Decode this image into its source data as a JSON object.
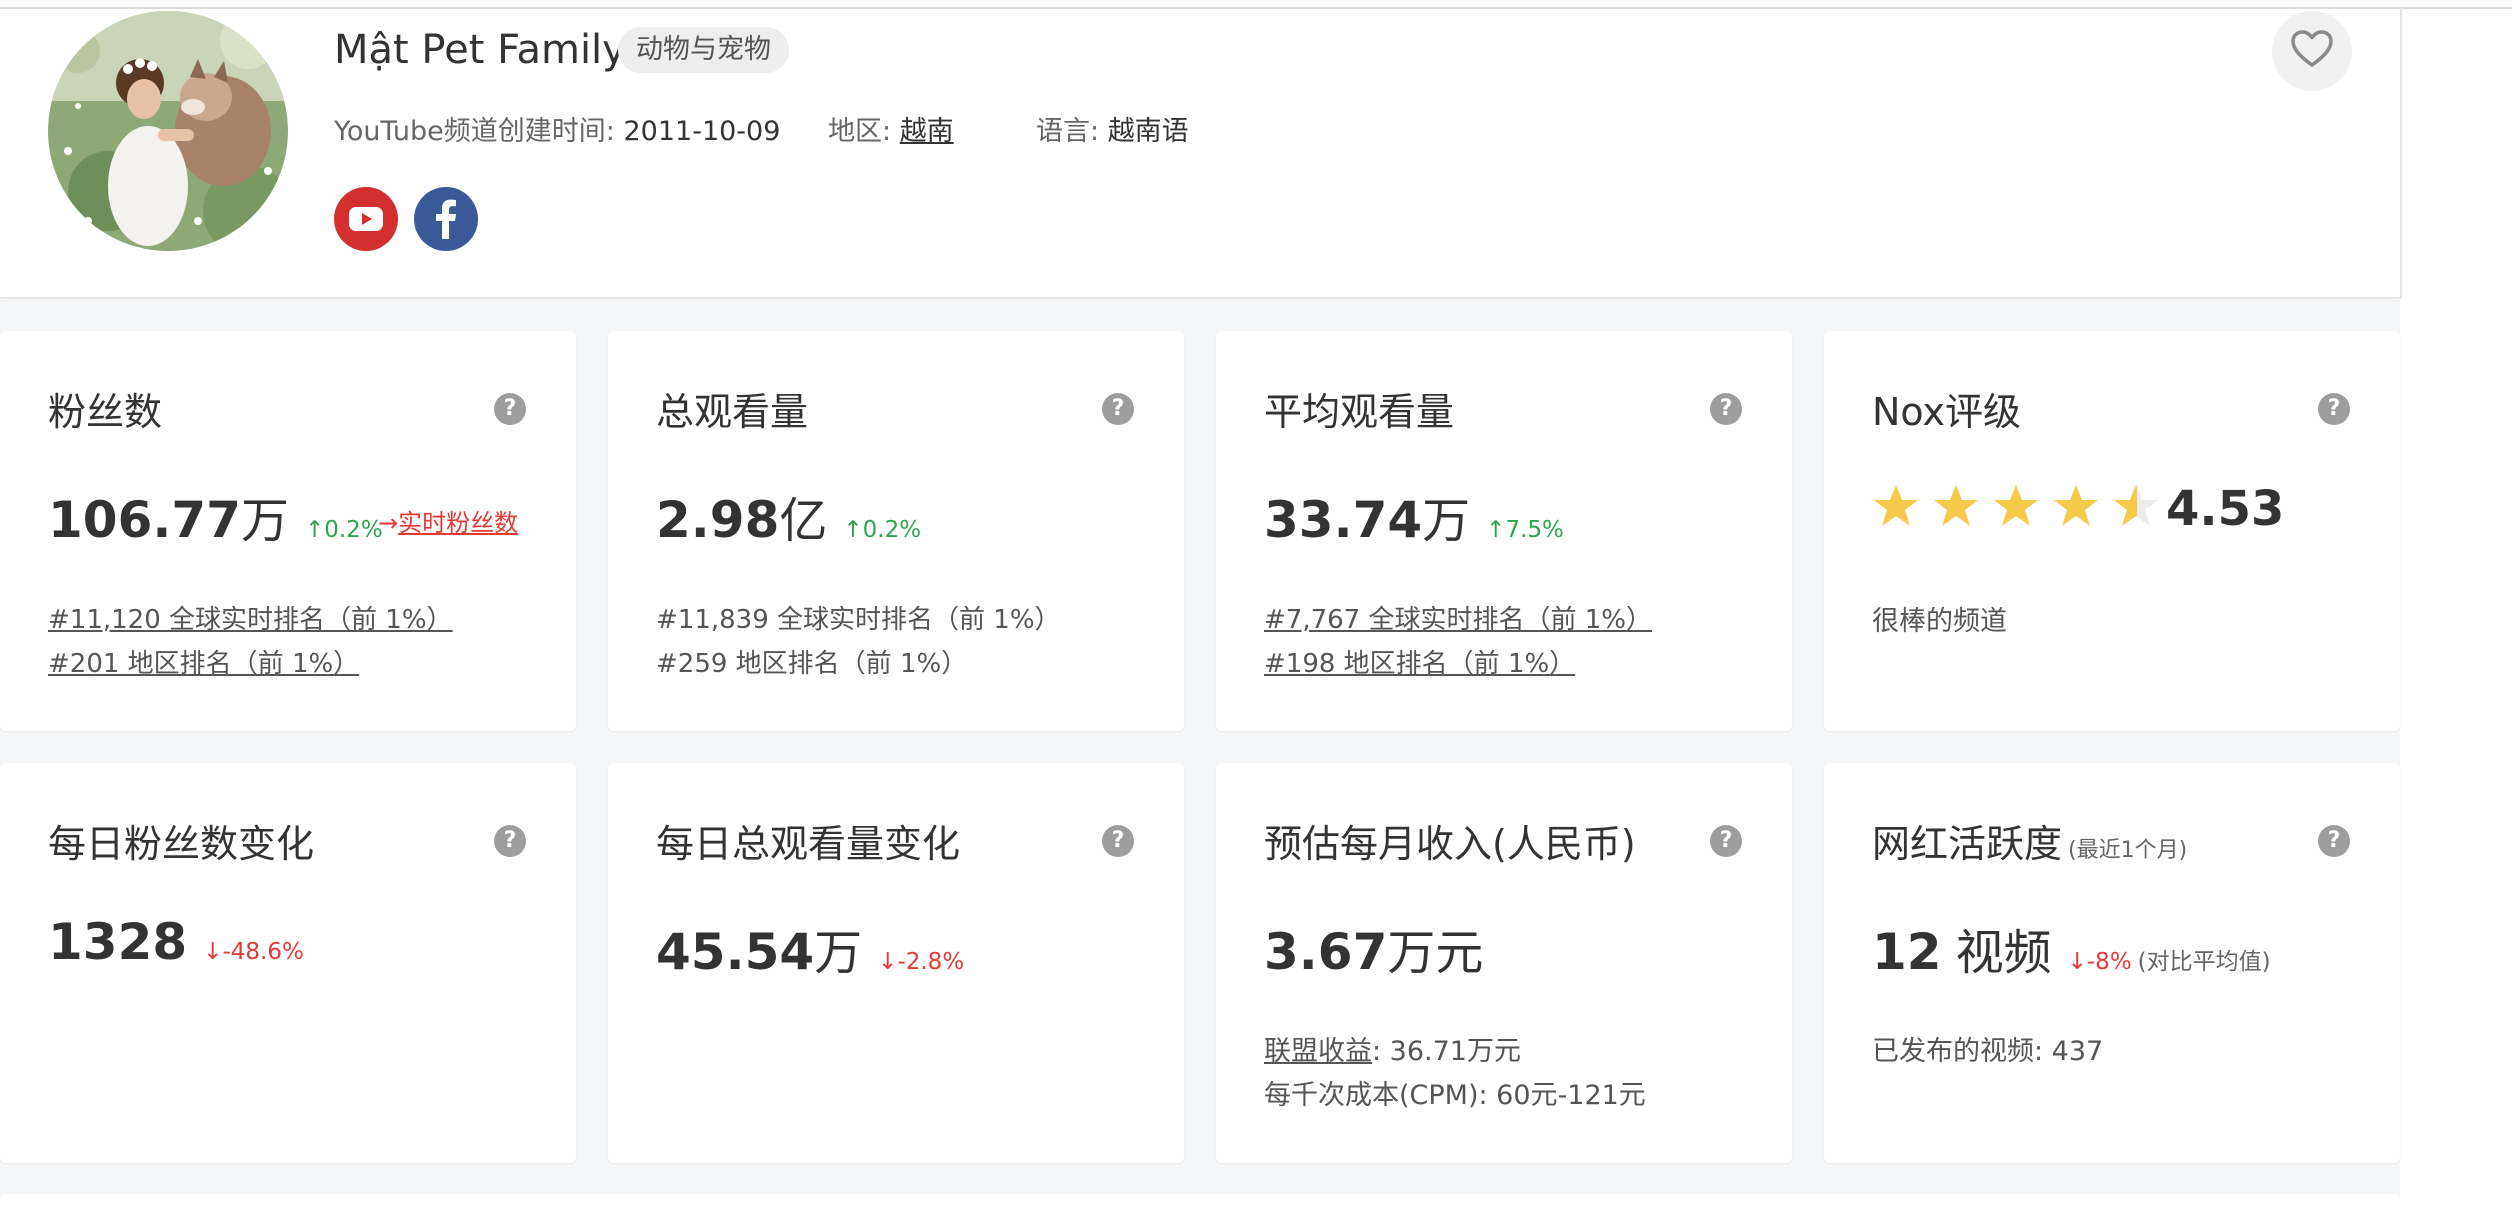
{
  "channel": {
    "name": "Mật Pet Family",
    "category": "动物与宠物",
    "created_label": "YouTube频道创建时间: ",
    "created_date": "2011-10-09",
    "region_label": "地区: ",
    "region": "越南",
    "language_label": "语言: ",
    "language": "越南语"
  },
  "icons": {
    "youtube": "youtube-icon",
    "facebook": "facebook-icon",
    "favorite": "heart-icon",
    "help": "question-icon"
  },
  "colors": {
    "youtube_red": "#d32f2f",
    "facebook_blue": "#3b5998",
    "up_green": "#2ea44f",
    "down_red": "#e53935",
    "star_yellow": "#f7c94a"
  },
  "cards": {
    "subscribers": {
      "title": "粉丝数",
      "value": "106.77",
      "unit": "万",
      "change": "↑0.2%",
      "realtime_link": "实时粉丝数",
      "rank_global": "#11,120 全球实时排名（前 1%）",
      "rank_region": "#201 地区排名（前 1%）"
    },
    "total_views": {
      "title": "总观看量",
      "value": "2.98",
      "unit": "亿",
      "change": "↑0.2%",
      "rank_global": "#11,839 全球实时排名（前 1%）",
      "rank_region": "#259 地区排名（前 1%）"
    },
    "avg_views": {
      "title": "平均观看量",
      "value": "33.74",
      "unit": "万",
      "change": "↑7.5%",
      "rank_global": "#7,767 全球实时排名（前 1%）",
      "rank_region": "#198 地区排名（前 1%）"
    },
    "nox_rating": {
      "title": "Nox评级",
      "rating": "4.53",
      "rating_value": 4.53,
      "desc": "很棒的频道"
    },
    "daily_subs": {
      "title": "每日粉丝数变化",
      "value": "1328",
      "change": "↓-48.6%"
    },
    "daily_views": {
      "title": "每日总观看量变化",
      "value": "45.54",
      "unit": "万",
      "change": "↓-2.8%"
    },
    "monthly_income": {
      "title": "预估每月收入(人民币)",
      "value": "3.67",
      "unit": "万元",
      "adsense_label": "联盟收益",
      "adsense_value": ": 36.71万元",
      "cpm": "每千次成本(CPM): 60元-121元"
    },
    "activity": {
      "title": "网红活跃度",
      "title_sub": "(最近1个月)",
      "value": "12",
      "unit": "视频",
      "change": "↓-8%",
      "change_note": "(对比平均值)",
      "published": "已发布的视频: 437"
    }
  }
}
